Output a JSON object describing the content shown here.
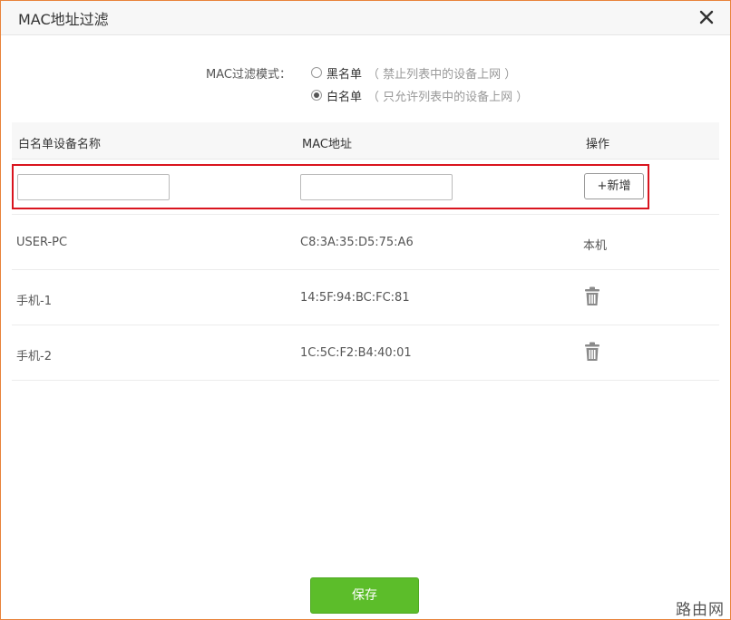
{
  "dialog": {
    "title": "MAC地址过滤",
    "close_icon": "close-icon"
  },
  "filter_mode": {
    "label": "MAC过滤模式：",
    "options": [
      {
        "label": "黑名单",
        "hint": "（ 禁止列表中的设备上网 ）",
        "checked": false
      },
      {
        "label": "白名单",
        "hint": "（ 只允许列表中的设备上网 ）",
        "checked": true
      }
    ]
  },
  "table": {
    "headers": [
      "白名单设备名称",
      "MAC地址",
      "操作"
    ],
    "add_row": {
      "name_value": "",
      "mac_value": "",
      "add_label": "+新增"
    },
    "rows": [
      {
        "name": "USER-PC",
        "mac": "C8:3A:35:D5:75:A6",
        "action": "本机"
      },
      {
        "name": "手机-1",
        "mac": "14:5F:94:BC:FC:81",
        "action_icon": "trash-icon"
      },
      {
        "name": "手机-2",
        "mac": "1C:5C:F2:B4:40:01",
        "action_icon": "trash-icon"
      }
    ]
  },
  "footer": {
    "save_label": "保存"
  },
  "watermark": "路由网",
  "colors": {
    "dialog_border": "#e8833a",
    "highlight_border": "#d9141e",
    "save_button": "#5cbd2a"
  }
}
